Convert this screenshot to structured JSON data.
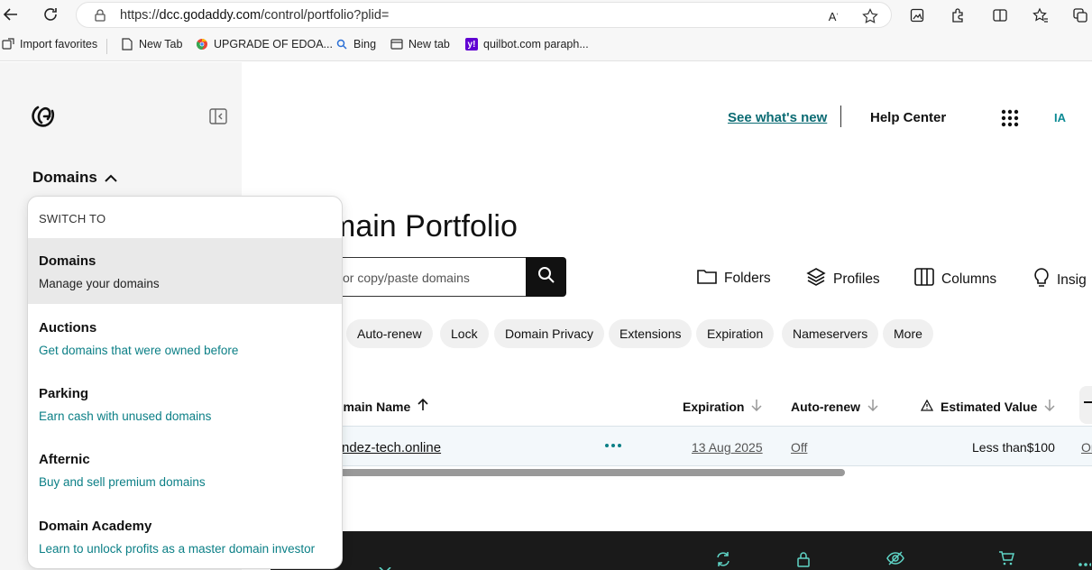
{
  "browser": {
    "url_prefix": "https://",
    "url_domain": "dcc.godaddy.com",
    "url_path": "/control/portfolio?plid="
  },
  "bookmarks": [
    {
      "label": "Import favorites",
      "icon": "import-icon"
    },
    {
      "label": "New Tab",
      "icon": "page-icon"
    },
    {
      "label": "UPGRADE OF EDOA...",
      "icon": "chrome-icon"
    },
    {
      "label": "Bing",
      "icon": "search-icon"
    },
    {
      "label": "New tab",
      "icon": "tab-icon"
    },
    {
      "label": "quilbot.com paraph...",
      "icon": "yahoo-icon"
    }
  ],
  "sidebar": {
    "section": "Domains"
  },
  "header": {
    "whats_new": "See what's new",
    "help": "Help Center",
    "avatar": "IA"
  },
  "page": {
    "title": "main Portfolio",
    "search_placeholder": "or copy/paste domains"
  },
  "toolbar": {
    "folders": "Folders",
    "profiles": "Profiles",
    "columns": "Columns",
    "insights": "Insig"
  },
  "filters": [
    "Auto-renew",
    "Lock",
    "Domain Privacy",
    "Extensions",
    "Expiration",
    "Nameservers",
    "More"
  ],
  "table": {
    "headers": {
      "name": "omain Name",
      "expiration": "Expiration",
      "autorenew": "Auto-renew",
      "value": "Estimated Value"
    },
    "rows": [
      {
        "name": "ndez-tech.online",
        "expiration": "13 Aug 2025",
        "autorenew": "Off",
        "value": "Less than$100",
        "extra": "Or"
      }
    ]
  },
  "dropdown": {
    "heading": "SWITCH TO",
    "items": [
      {
        "title": "Domains",
        "subtitle": "Manage your domains"
      },
      {
        "title": "Auctions",
        "subtitle": "Get domains that were owned before"
      },
      {
        "title": "Parking",
        "subtitle": "Earn cash with unused domains"
      },
      {
        "title": "Afternic",
        "subtitle": "Buy and sell premium domains"
      },
      {
        "title": "Domain Academy",
        "subtitle": "Learn to unlock profits as a master domain investor"
      }
    ]
  },
  "colors": {
    "accent": "#0b7f86",
    "dark": "#111111"
  }
}
